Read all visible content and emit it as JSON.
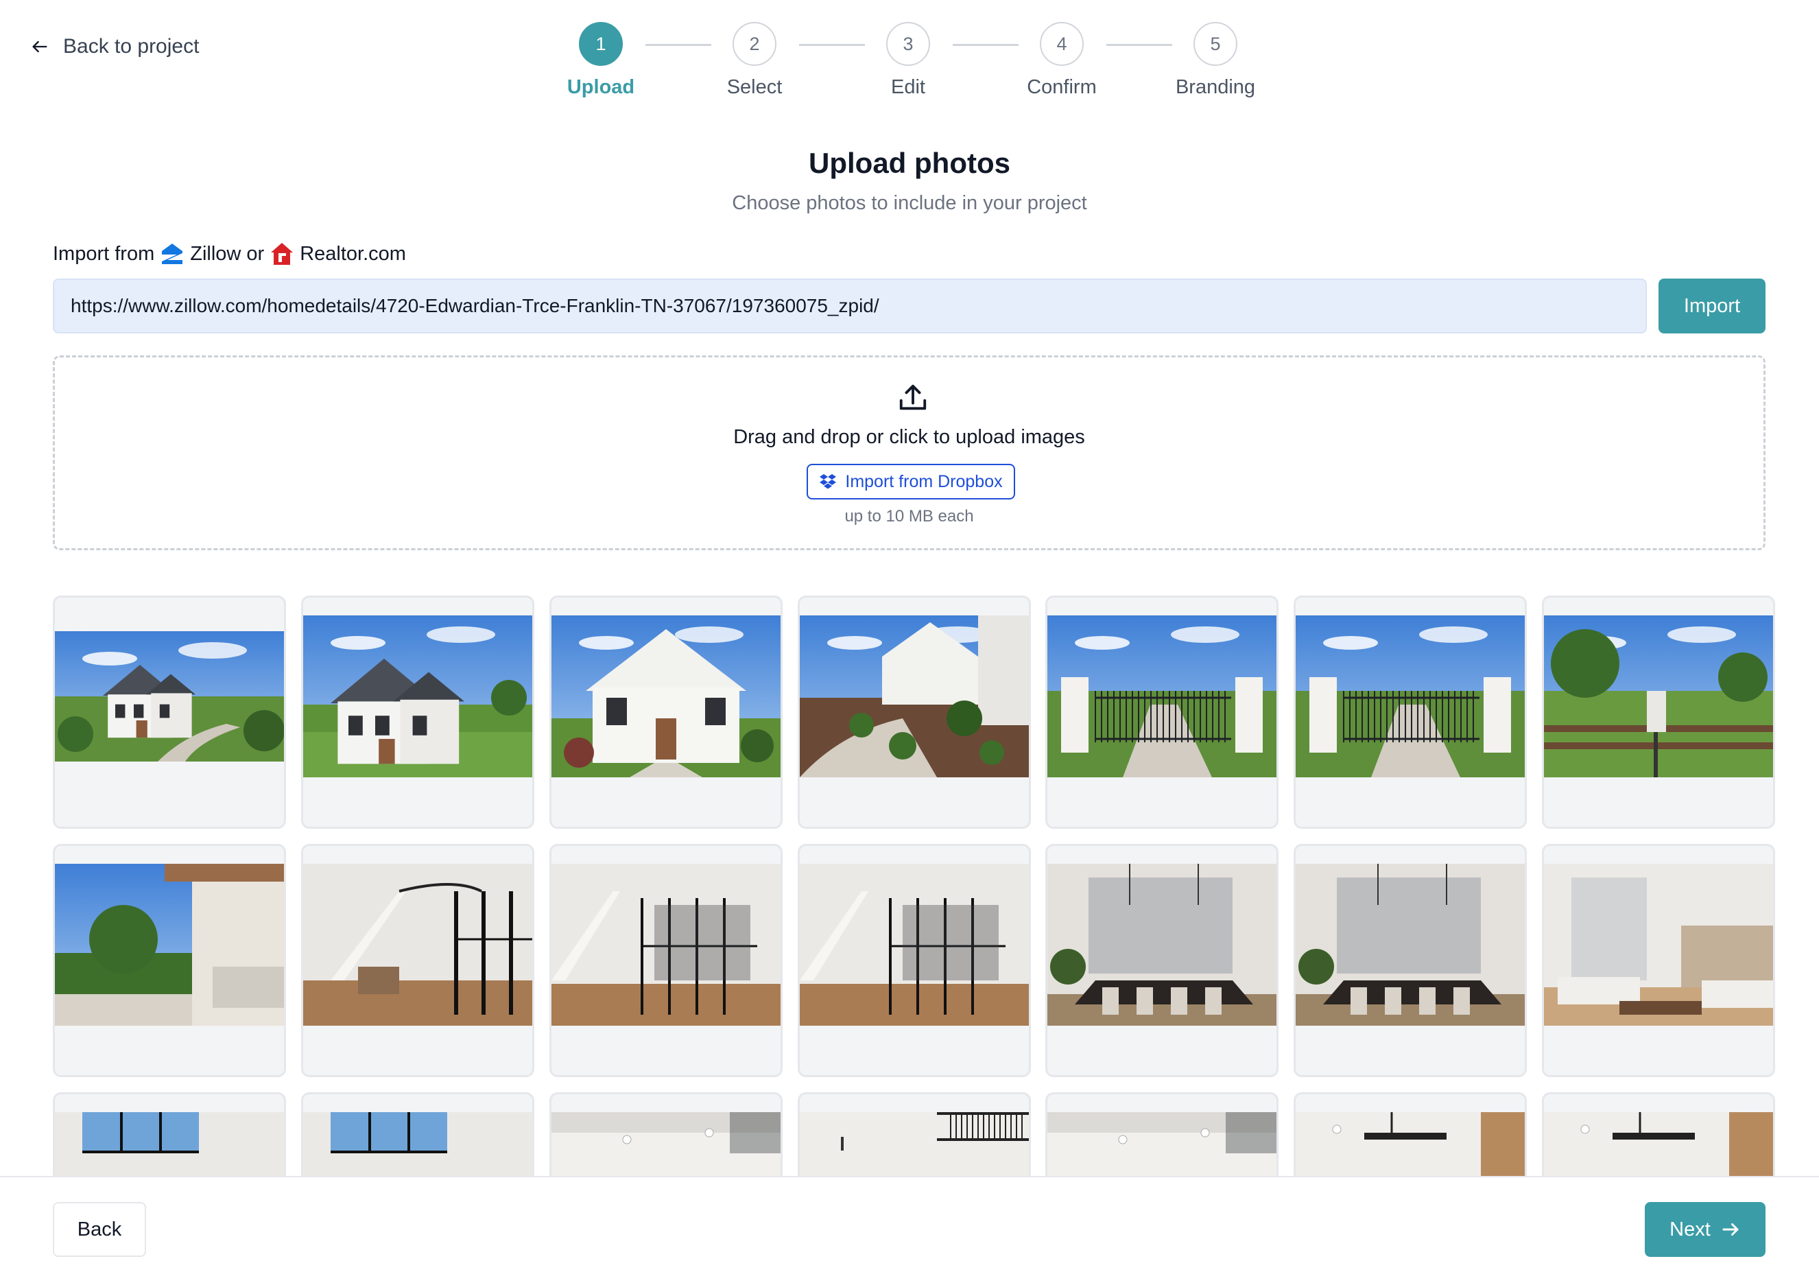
{
  "nav": {
    "back_to_project": "Back to project"
  },
  "stepper": {
    "current_step": 1,
    "steps": [
      {
        "number": "1",
        "label": "Upload"
      },
      {
        "number": "2",
        "label": "Select"
      },
      {
        "number": "3",
        "label": "Edit"
      },
      {
        "number": "4",
        "label": "Confirm"
      },
      {
        "number": "5",
        "label": "Branding"
      }
    ]
  },
  "header": {
    "title": "Upload photos",
    "subtitle": "Choose photos to include in your project"
  },
  "import": {
    "prefix": "Import from",
    "zillow": "Zillow or",
    "realtor": "Realtor.com",
    "url_value": "https://www.zillow.com/homedetails/4720-Edwardian-Trce-Franklin-TN-37067/197360075_zpid/",
    "button_label": "Import"
  },
  "dropzone": {
    "title": "Drag and drop or click to upload images",
    "dropbox_label": "Import from Dropbox",
    "hint": "up to 10 MB each"
  },
  "photos": [
    {
      "scene": "exterior-aerial"
    },
    {
      "scene": "exterior-lawn"
    },
    {
      "scene": "exterior-front"
    },
    {
      "scene": "exterior-landscape"
    },
    {
      "scene": "gate"
    },
    {
      "scene": "gate"
    },
    {
      "scene": "fence-field"
    },
    {
      "scene": "porch"
    },
    {
      "scene": "foyer-stairs"
    },
    {
      "scene": "foyer-glass"
    },
    {
      "scene": "foyer-glass"
    },
    {
      "scene": "dining"
    },
    {
      "scene": "dining"
    },
    {
      "scene": "living"
    },
    {
      "scene": "interior-window"
    },
    {
      "scene": "interior-window"
    },
    {
      "scene": "interior-ceiling"
    },
    {
      "scene": "interior-railing"
    },
    {
      "scene": "interior-ceiling"
    },
    {
      "scene": "kitchen"
    },
    {
      "scene": "kitchen"
    }
  ],
  "footer": {
    "back_label": "Back",
    "next_label": "Next"
  },
  "colors": {
    "accent": "#3a9ca6",
    "input_bg": "#e6eefc",
    "link_blue": "#1d4ed8",
    "zillow_blue": "#1277e1",
    "realtor_red": "#d92228"
  }
}
